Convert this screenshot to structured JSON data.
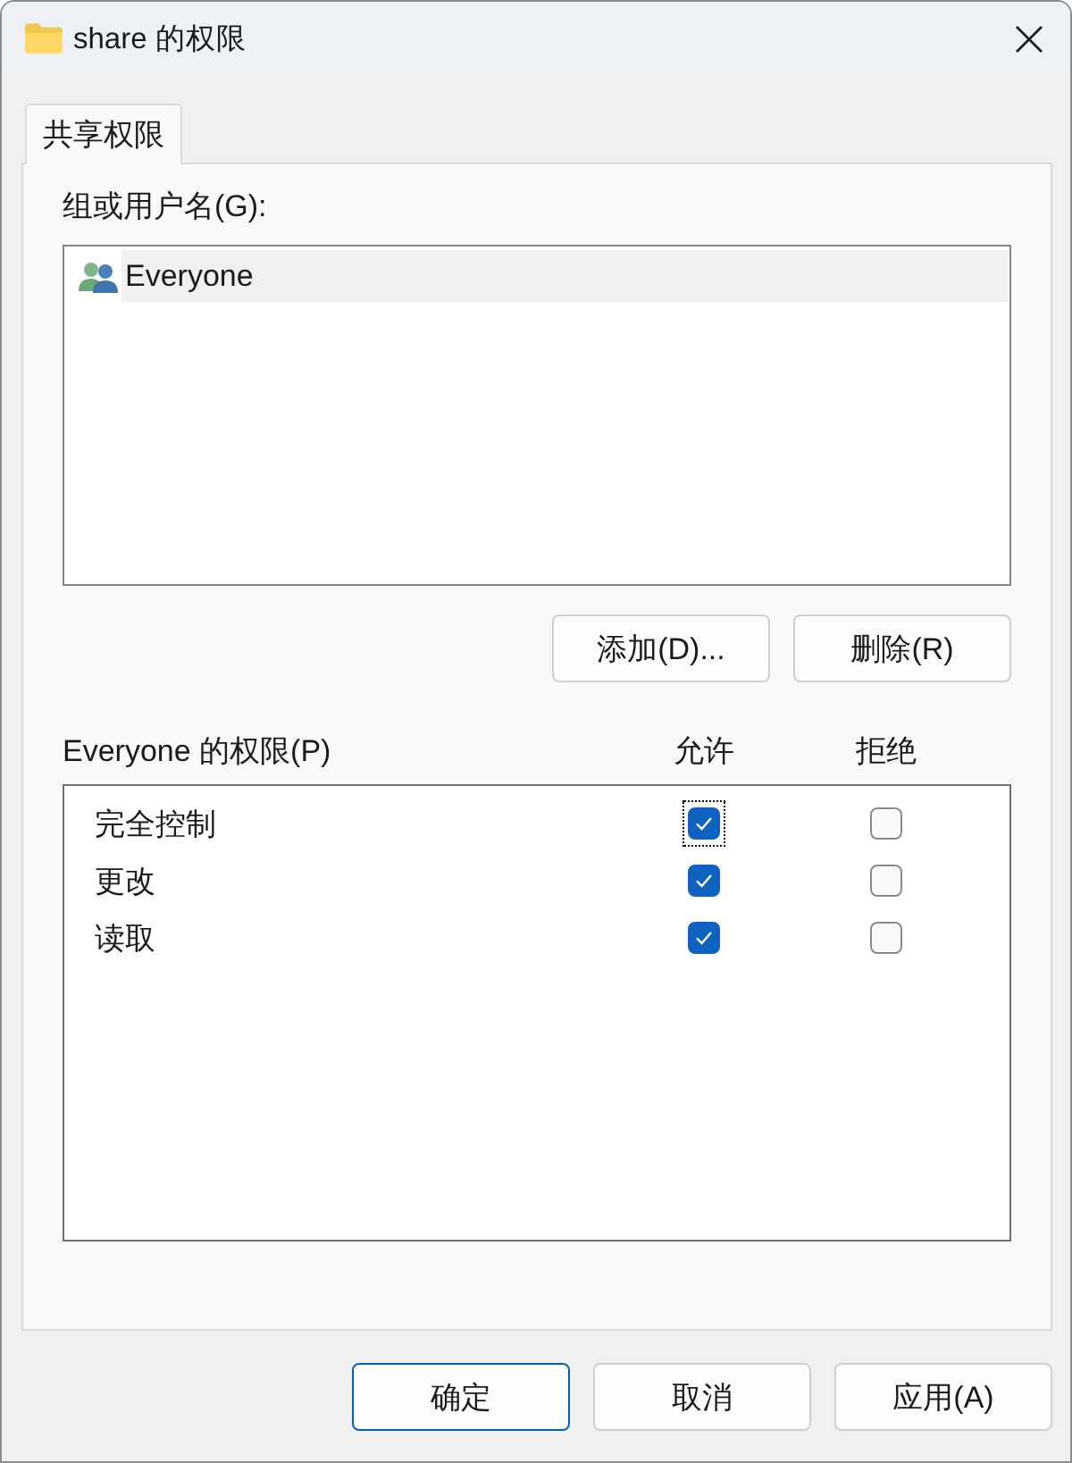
{
  "window": {
    "title": "share 的权限"
  },
  "tabs": [
    {
      "label": "共享权限",
      "selected": true
    }
  ],
  "groups": {
    "label": "组或用户名(G):",
    "items": [
      {
        "name": "Everyone",
        "selected": true
      }
    ]
  },
  "group_buttons": [
    {
      "label": "添加(D)..."
    },
    {
      "label": "删除(R)"
    }
  ],
  "permissions": {
    "label": "Everyone 的权限(P)",
    "columns": [
      "允许",
      "拒绝"
    ],
    "rows": [
      {
        "name": "完全控制",
        "allow": {
          "checked": true,
          "focused": true
        },
        "deny": {
          "checked": false,
          "focused": false
        }
      },
      {
        "name": "更改",
        "allow": {
          "checked": true,
          "focused": false
        },
        "deny": {
          "checked": false,
          "focused": false
        }
      },
      {
        "name": "读取",
        "allow": {
          "checked": true,
          "focused": false
        },
        "deny": {
          "checked": false,
          "focused": false
        }
      }
    ]
  },
  "dialog_buttons": [
    {
      "label": "确定",
      "default": true
    },
    {
      "label": "取消",
      "default": false
    },
    {
      "label": "应用(A)",
      "default": false
    }
  ]
}
